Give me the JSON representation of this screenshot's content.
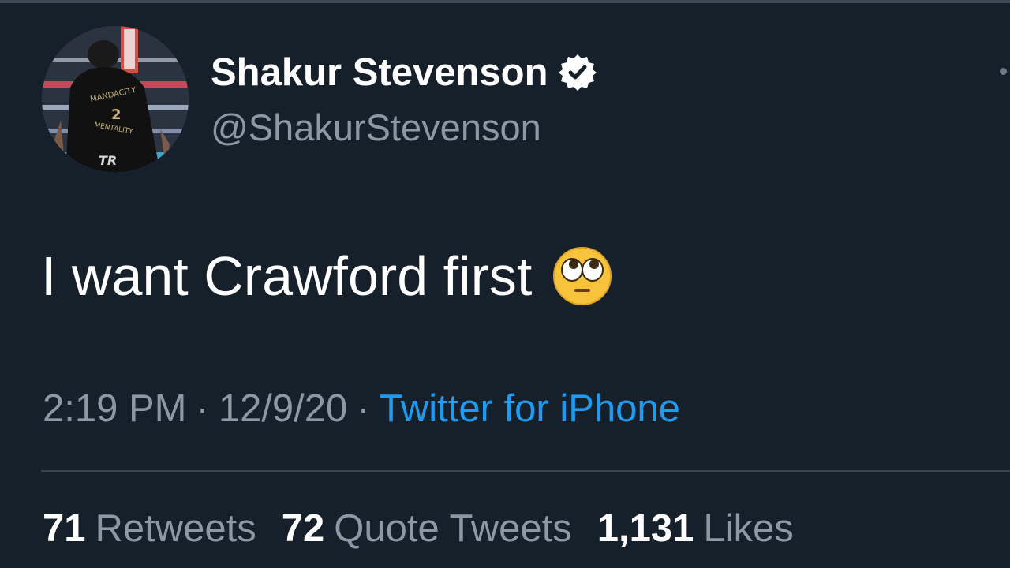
{
  "tweet": {
    "author": {
      "display_name": "Shakur Stevenson",
      "handle": "@ShakurStevenson",
      "verified_icon": "verified-badge-icon",
      "avatar_icon": "avatar-boxer-photo"
    },
    "text": "I want Crawford first",
    "emoji": "face-with-rolling-eyes-icon",
    "time": "2:19 PM",
    "separator": "·",
    "date": "12/9/20",
    "source": "Twitter for iPhone",
    "stats": {
      "retweets_count": "71",
      "retweets_label": "Retweets",
      "quotes_count": "72",
      "quotes_label": "Quote Tweets",
      "likes_count": "1,131",
      "likes_label": "Likes"
    }
  },
  "colors": {
    "background": "#15202b",
    "secondary_text": "#8b98a5",
    "link": "#1d9bf0",
    "divider": "#38444d"
  }
}
